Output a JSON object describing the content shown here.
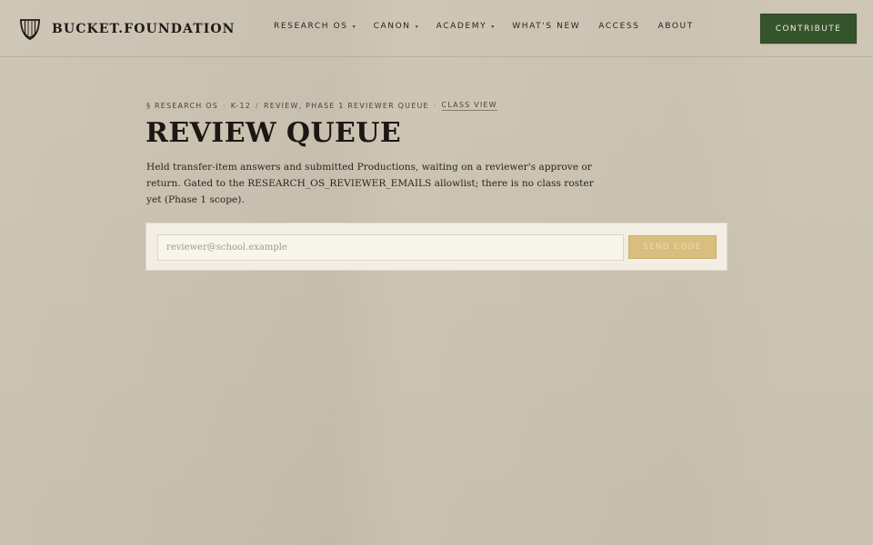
{
  "header": {
    "brand_name": "BUCKET.FOUNDATION",
    "brand_icon": "lyre-shield-icon",
    "nav": [
      {
        "label": "RESEARCH OS",
        "has_dropdown": true
      },
      {
        "label": "CANON",
        "has_dropdown": true
      },
      {
        "label": "ACADEMY",
        "has_dropdown": true
      },
      {
        "label": "WHAT'S NEW",
        "has_dropdown": false
      },
      {
        "label": "ACCESS",
        "has_dropdown": false
      },
      {
        "label": "ABOUT",
        "has_dropdown": false
      }
    ],
    "caret_glyph": "▾",
    "contribute_label": "CONTRIBUTE"
  },
  "breadcrumb": {
    "items": [
      "§ RESEARCH OS",
      "K-12",
      "REVIEW, PHASE 1 REVIEWER QUEUE"
    ],
    "separators": [
      "·",
      "/",
      "·"
    ],
    "link": "CLASS VIEW"
  },
  "page": {
    "title": "REVIEW QUEUE",
    "description": "Held transfer-item answers and submitted Productions, waiting on a reviewer's approve or return. Gated to the RESEARCH_OS_REVIEWER_EMAILS allowlist; there is no class roster yet (Phase 1 scope)."
  },
  "form": {
    "email_placeholder": "reviewer@school.example",
    "email_value": "",
    "send_label": "SEND CODE"
  },
  "colors": {
    "background": "#cdc4b3",
    "contribute_bg": "#35542b",
    "send_bg": "#d8bf7f",
    "panel_bg": "#f2eee3",
    "text": "#1f1a14"
  }
}
